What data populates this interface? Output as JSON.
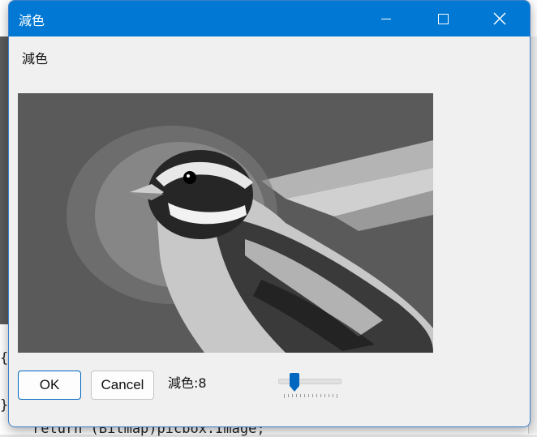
{
  "dialog": {
    "title": "減色",
    "caption_label": "減色",
    "buttons": {
      "ok": "OK",
      "cancel": "Cancel"
    },
    "reduce_label_prefix": "減色:",
    "reduce_value": "8",
    "slider": {
      "value": 8,
      "min": 1,
      "max": 64
    },
    "image_alt": "posterized sparrow photo"
  },
  "background_code": {
    "line_brace_open": "{",
    "line_brace_close": "}",
    "line_return": "return (Bitmap)picbox.Image;"
  },
  "colors": {
    "titlebar": "#0078d4",
    "accent": "#0067c0",
    "window_bg": "#f0f0f0"
  }
}
